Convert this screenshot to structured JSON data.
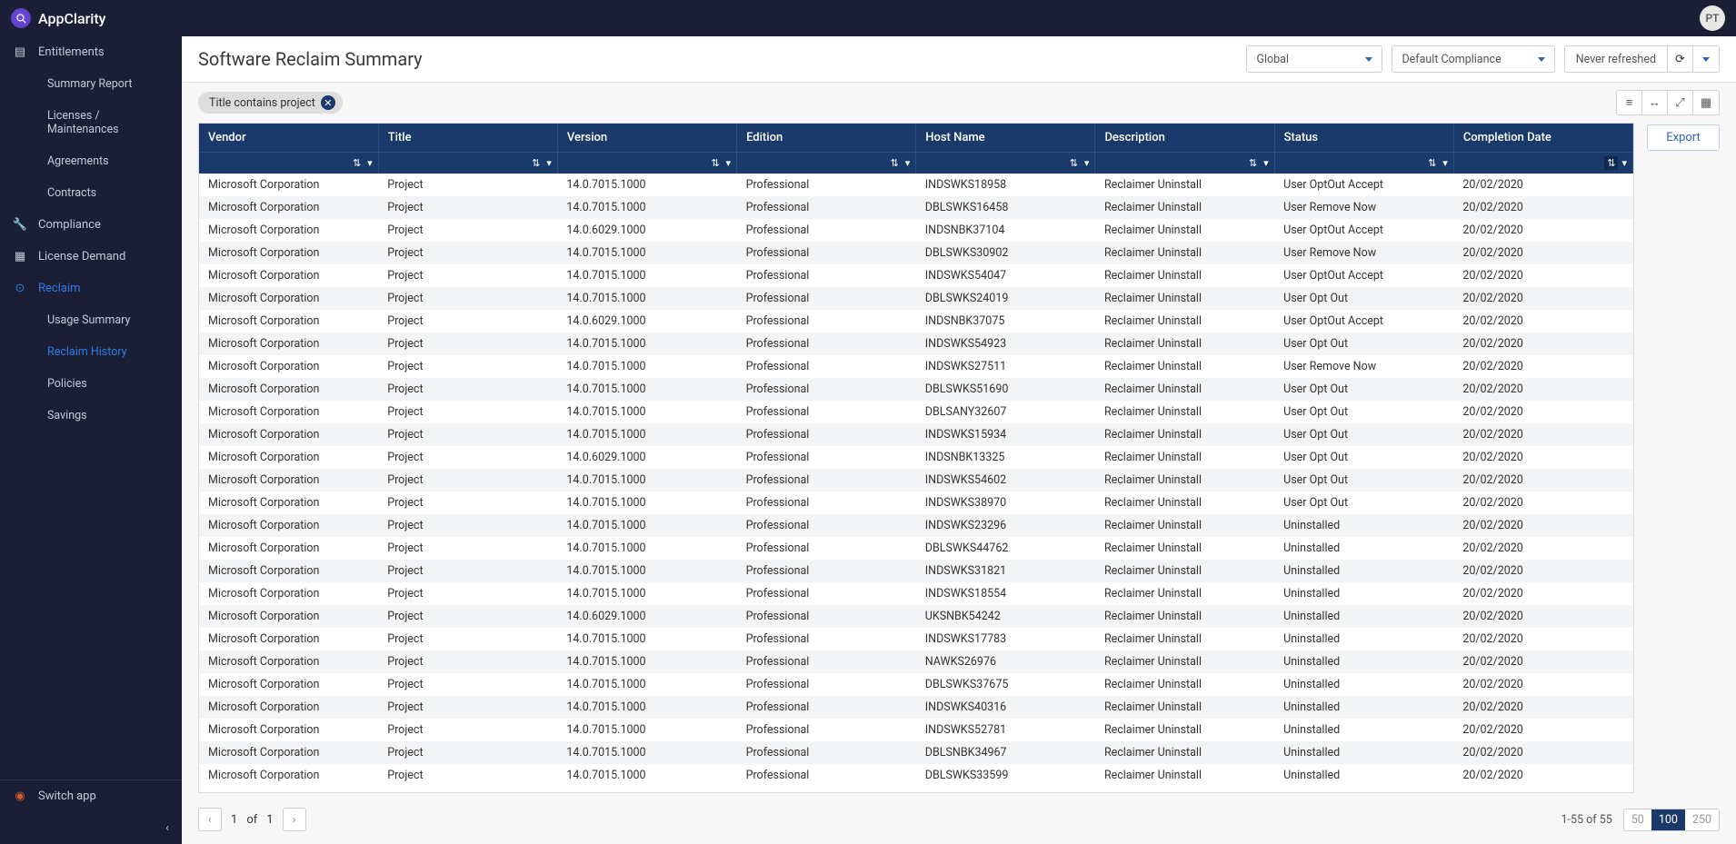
{
  "brand": "AppClarity",
  "avatar": "PT",
  "nav": {
    "entitlements": "Entitlements",
    "summary_report": "Summary Report",
    "licenses_maint": "Licenses / Maintenances",
    "agreements": "Agreements",
    "contracts": "Contracts",
    "compliance": "Compliance",
    "license_demand": "License Demand",
    "reclaim": "Reclaim",
    "usage_summary": "Usage Summary",
    "reclaim_history": "Reclaim History",
    "policies": "Policies",
    "savings": "Savings",
    "switch_app": "Switch app"
  },
  "page_title": "Software Reclaim Summary",
  "dropdowns": {
    "scope": "Global",
    "compliance": "Default Compliance",
    "refreshed": "Never refreshed"
  },
  "filter_chip": "Title contains project",
  "export_label": "Export",
  "columns": [
    "Vendor",
    "Title",
    "Version",
    "Edition",
    "Host Name",
    "Description",
    "Status",
    "Completion Date"
  ],
  "rows": [
    [
      "Microsoft Corporation",
      "Project",
      "14.0.7015.1000",
      "Professional",
      "INDSWKS18958",
      "Reclaimer Uninstall",
      "User OptOut Accept",
      "20/02/2020"
    ],
    [
      "Microsoft Corporation",
      "Project",
      "14.0.7015.1000",
      "Professional",
      "DBLSWKS16458",
      "Reclaimer Uninstall",
      "User Remove Now",
      "20/02/2020"
    ],
    [
      "Microsoft Corporation",
      "Project",
      "14.0.6029.1000",
      "Professional",
      "INDSNBK37104",
      "Reclaimer Uninstall",
      "User OptOut Accept",
      "20/02/2020"
    ],
    [
      "Microsoft Corporation",
      "Project",
      "14.0.7015.1000",
      "Professional",
      "DBLSWKS30902",
      "Reclaimer Uninstall",
      "User Remove Now",
      "20/02/2020"
    ],
    [
      "Microsoft Corporation",
      "Project",
      "14.0.7015.1000",
      "Professional",
      "INDSWKS54047",
      "Reclaimer Uninstall",
      "User OptOut Accept",
      "20/02/2020"
    ],
    [
      "Microsoft Corporation",
      "Project",
      "14.0.7015.1000",
      "Professional",
      "DBLSWKS24019",
      "Reclaimer Uninstall",
      "User Opt Out",
      "20/02/2020"
    ],
    [
      "Microsoft Corporation",
      "Project",
      "14.0.6029.1000",
      "Professional",
      "INDSNBK37075",
      "Reclaimer Uninstall",
      "User OptOut Accept",
      "20/02/2020"
    ],
    [
      "Microsoft Corporation",
      "Project",
      "14.0.7015.1000",
      "Professional",
      "INDSWKS54923",
      "Reclaimer Uninstall",
      "User Opt Out",
      "20/02/2020"
    ],
    [
      "Microsoft Corporation",
      "Project",
      "14.0.7015.1000",
      "Professional",
      "INDSWKS27511",
      "Reclaimer Uninstall",
      "User Remove Now",
      "20/02/2020"
    ],
    [
      "Microsoft Corporation",
      "Project",
      "14.0.7015.1000",
      "Professional",
      "DBLSWKS51690",
      "Reclaimer Uninstall",
      "User Opt Out",
      "20/02/2020"
    ],
    [
      "Microsoft Corporation",
      "Project",
      "14.0.7015.1000",
      "Professional",
      "DBLSANY32607",
      "Reclaimer Uninstall",
      "User Opt Out",
      "20/02/2020"
    ],
    [
      "Microsoft Corporation",
      "Project",
      "14.0.7015.1000",
      "Professional",
      "INDSWKS15934",
      "Reclaimer Uninstall",
      "User Opt Out",
      "20/02/2020"
    ],
    [
      "Microsoft Corporation",
      "Project",
      "14.0.6029.1000",
      "Professional",
      "INDSNBK13325",
      "Reclaimer Uninstall",
      "User Opt Out",
      "20/02/2020"
    ],
    [
      "Microsoft Corporation",
      "Project",
      "14.0.7015.1000",
      "Professional",
      "INDSWKS54602",
      "Reclaimer Uninstall",
      "User Opt Out",
      "20/02/2020"
    ],
    [
      "Microsoft Corporation",
      "Project",
      "14.0.7015.1000",
      "Professional",
      "INDSWKS38970",
      "Reclaimer Uninstall",
      "User Opt Out",
      "20/02/2020"
    ],
    [
      "Microsoft Corporation",
      "Project",
      "14.0.7015.1000",
      "Professional",
      "INDSWKS23296",
      "Reclaimer Uninstall",
      "Uninstalled",
      "20/02/2020"
    ],
    [
      "Microsoft Corporation",
      "Project",
      "14.0.7015.1000",
      "Professional",
      "DBLSWKS44762",
      "Reclaimer Uninstall",
      "Uninstalled",
      "20/02/2020"
    ],
    [
      "Microsoft Corporation",
      "Project",
      "14.0.7015.1000",
      "Professional",
      "INDSWKS31821",
      "Reclaimer Uninstall",
      "Uninstalled",
      "20/02/2020"
    ],
    [
      "Microsoft Corporation",
      "Project",
      "14.0.7015.1000",
      "Professional",
      "INDSWKS18554",
      "Reclaimer Uninstall",
      "Uninstalled",
      "20/02/2020"
    ],
    [
      "Microsoft Corporation",
      "Project",
      "14.0.6029.1000",
      "Professional",
      "UKSNBK54242",
      "Reclaimer Uninstall",
      "Uninstalled",
      "20/02/2020"
    ],
    [
      "Microsoft Corporation",
      "Project",
      "14.0.7015.1000",
      "Professional",
      "INDSWKS17783",
      "Reclaimer Uninstall",
      "Uninstalled",
      "20/02/2020"
    ],
    [
      "Microsoft Corporation",
      "Project",
      "14.0.7015.1000",
      "Professional",
      "NAWKS26976",
      "Reclaimer Uninstall",
      "Uninstalled",
      "20/02/2020"
    ],
    [
      "Microsoft Corporation",
      "Project",
      "14.0.7015.1000",
      "Professional",
      "DBLSWKS37675",
      "Reclaimer Uninstall",
      "Uninstalled",
      "20/02/2020"
    ],
    [
      "Microsoft Corporation",
      "Project",
      "14.0.7015.1000",
      "Professional",
      "INDSWKS40316",
      "Reclaimer Uninstall",
      "Uninstalled",
      "20/02/2020"
    ],
    [
      "Microsoft Corporation",
      "Project",
      "14.0.7015.1000",
      "Professional",
      "INDSWKS52781",
      "Reclaimer Uninstall",
      "Uninstalled",
      "20/02/2020"
    ],
    [
      "Microsoft Corporation",
      "Project",
      "14.0.7015.1000",
      "Professional",
      "DBLSNBK34967",
      "Reclaimer Uninstall",
      "Uninstalled",
      "20/02/2020"
    ],
    [
      "Microsoft Corporation",
      "Project",
      "14.0.7015.1000",
      "Professional",
      "DBLSWKS33599",
      "Reclaimer Uninstall",
      "Uninstalled",
      "20/02/2020"
    ]
  ],
  "pagination": {
    "current": "1",
    "of": "of",
    "total": "1",
    "range": "1-55 of 55",
    "sizes": [
      "50",
      "100",
      "250"
    ],
    "active_size": "100"
  }
}
